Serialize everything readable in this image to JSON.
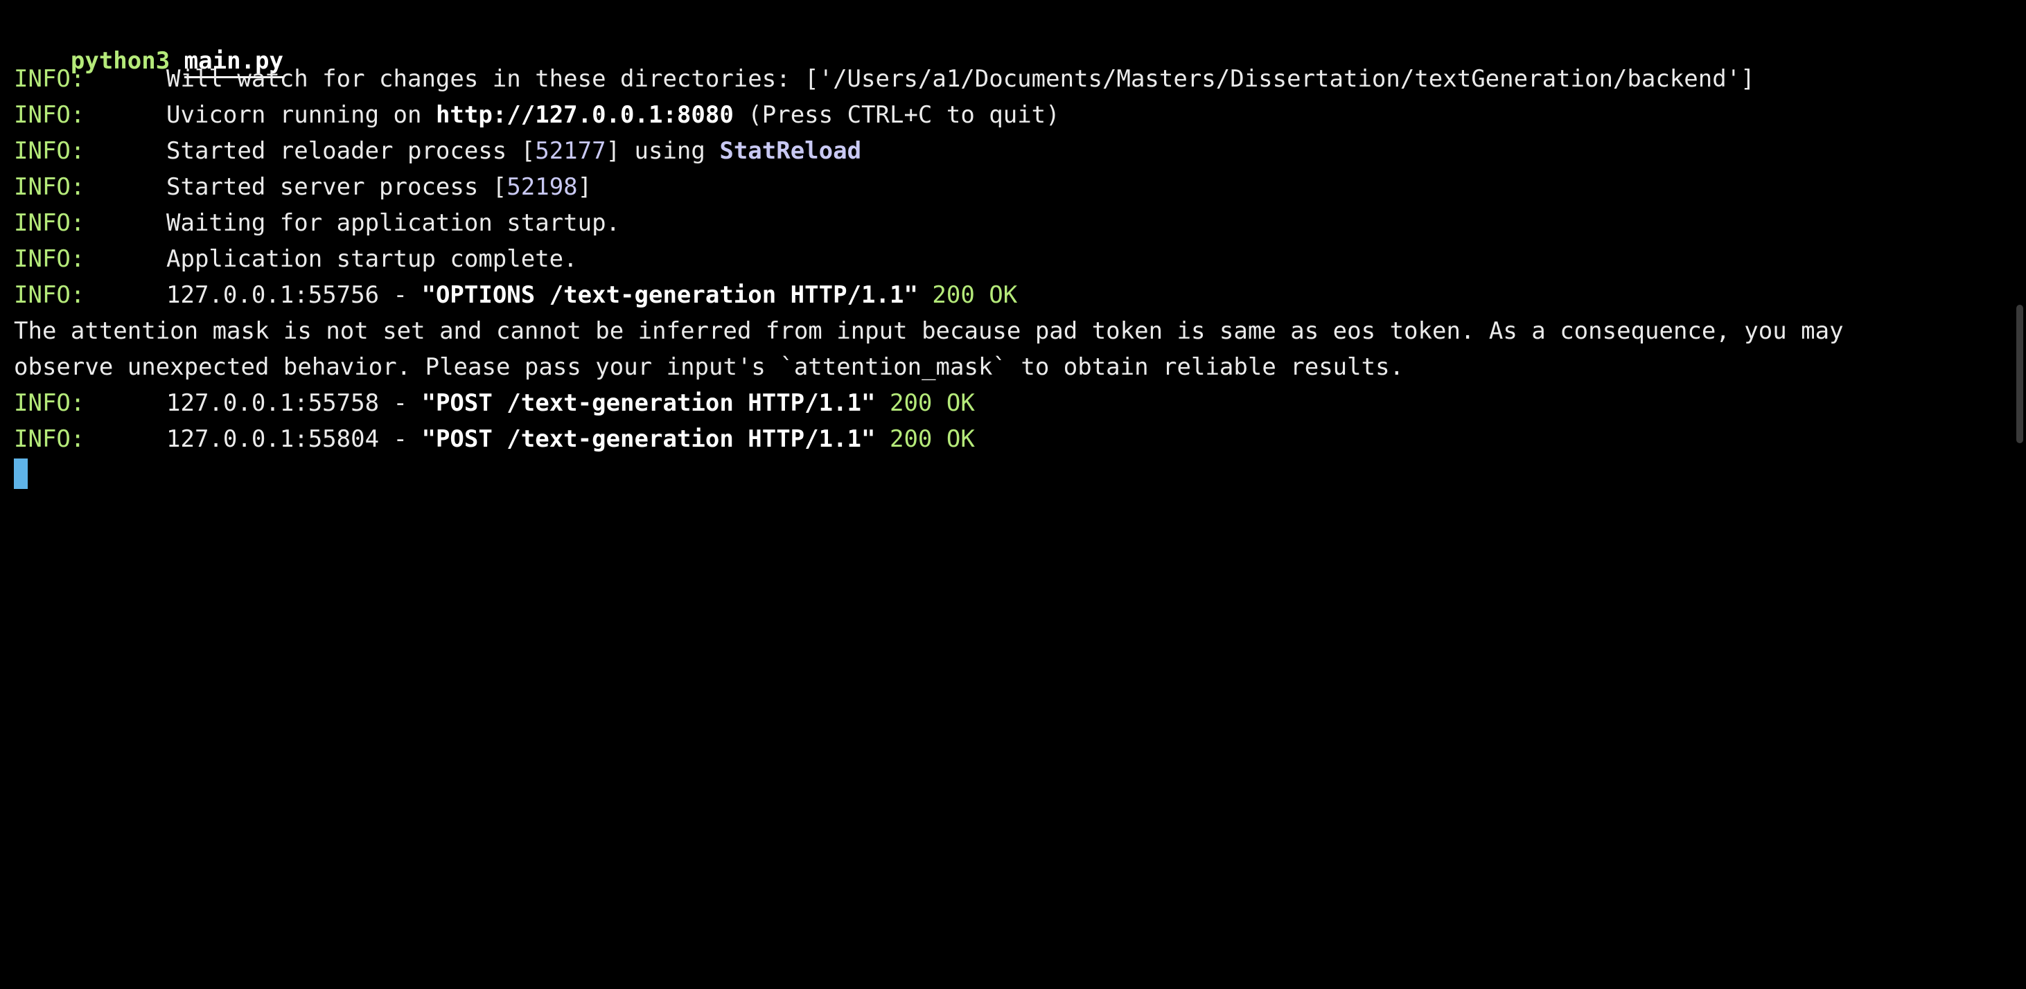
{
  "prompt": {
    "command": "python3",
    "file": "main.py"
  },
  "log": [
    {
      "level": "INFO:",
      "text": "Will watch for changes in these directories: ['/Users/a1/Documents/Masters/Dissertation/textGeneration/backend']"
    },
    {
      "level": "INFO:",
      "pre": "Uvicorn running on ",
      "url": "http://127.0.0.1:8080",
      "post": " (Press CTRL+C to quit)"
    },
    {
      "level": "INFO:",
      "pre": "Started reloader process [",
      "pid": "52177",
      "post": "] using ",
      "reloader": "StatReload"
    },
    {
      "level": "INFO:",
      "pre": "Started server process [",
      "pid": "52198",
      "post": "]"
    },
    {
      "level": "INFO:",
      "text": "Waiting for application startup."
    },
    {
      "level": "INFO:",
      "text": "Application startup complete."
    },
    {
      "level": "INFO:",
      "client": "127.0.0.1:55756",
      "request": "\"OPTIONS /text-generation HTTP/1.1\"",
      "status": "200 OK"
    },
    {
      "warning_line1": "The attention mask is not set and cannot be inferred from input because pad token is same as eos token. As a consequence, you may",
      "warning_line2": "observe unexpected behavior. Please pass your input's `attention_mask` to obtain reliable results."
    },
    {
      "level": "INFO:",
      "client": "127.0.0.1:55758",
      "request": "\"POST /text-generation HTTP/1.1\"",
      "status": "200 OK"
    },
    {
      "level": "INFO:",
      "client": "127.0.0.1:55804",
      "request": "\"POST /text-generation HTTP/1.1\"",
      "status": "200 OK"
    }
  ],
  "colors": {
    "background": "#000000",
    "foreground": "#ebebeb",
    "info": "#b5ea7a",
    "pid": "#c9c9f3",
    "cursor": "#5fb4e8"
  }
}
